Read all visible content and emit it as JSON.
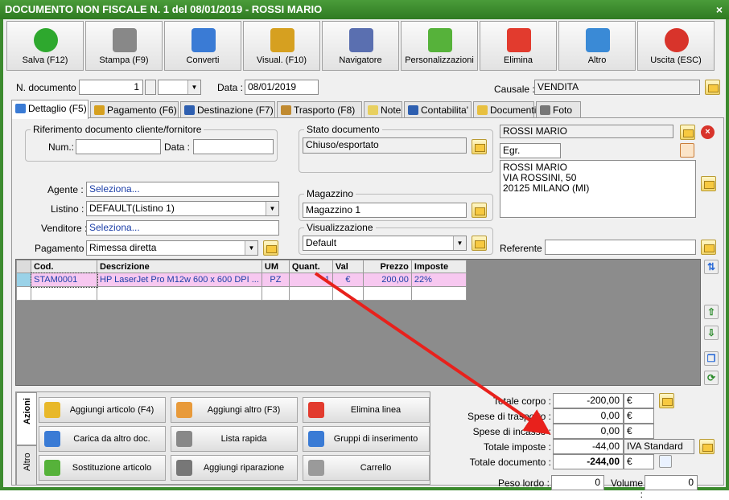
{
  "window": {
    "title": "DOCUMENTO NON FISCALE N. 1 del 08/01/2019 - ROSSI MARIO",
    "close": "×"
  },
  "toolbar": [
    {
      "label": "Salva (F12)",
      "icon": "check-icon",
      "color": "#2ea82e"
    },
    {
      "label": "Stampa (F9)",
      "icon": "printer-icon",
      "color": "#888888"
    },
    {
      "label": "Converti",
      "icon": "convert-icon",
      "color": "#3a7bd5"
    },
    {
      "label": "Visual. (F10)",
      "icon": "magic-wand-icon",
      "color": "#d6a020"
    },
    {
      "label": "Navigatore",
      "icon": "compass-icon",
      "color": "#5a6fb0"
    },
    {
      "label": "Personalizzazioni",
      "icon": "puzzle-icon",
      "color": "#56b23a"
    },
    {
      "label": "Elimina",
      "icon": "delete-x-icon",
      "color": "#e23b2e"
    },
    {
      "label": "Altro",
      "icon": "magnifier-icon",
      "color": "#3a8ad6"
    },
    {
      "label": "Uscita (ESC)",
      "icon": "power-icon",
      "color": "#d8342b"
    }
  ],
  "header": {
    "ndoc_label": "N. documento :",
    "ndoc_value": "1",
    "data_label": "Data :",
    "data_value": "08/01/2019",
    "causale_label": "Causale :",
    "causale_value": "VENDITA"
  },
  "tabs": [
    {
      "label": "Dettaglio (F5)",
      "color": "#3a7bd5"
    },
    {
      "label": "Pagamento (F6)",
      "color": "#d6a020"
    },
    {
      "label": "Destinazione (F7)",
      "color": "#2e5fb0"
    },
    {
      "label": "Trasporto (F8)",
      "color": "#c08a30"
    },
    {
      "label": "Note",
      "color": "#e8d060"
    },
    {
      "label": "Contabilita'",
      "color": "#2e5fb0"
    },
    {
      "label": "Documenti",
      "color": "#e8c040"
    },
    {
      "label": "Foto",
      "color": "#777777"
    }
  ],
  "riferimento": {
    "title": "Riferimento documento cliente/fornitore",
    "num_label": "Num.:",
    "data_label": "Data :"
  },
  "fields": {
    "agente_label": "Agente :",
    "agente_value": "Seleziona...",
    "listino_label": "Listino :",
    "listino_value": "DEFAULT(Listino 1)",
    "venditore_label": "Venditore :",
    "venditore_value": "Seleziona...",
    "pagamento_label": "Pagamento :",
    "pagamento_value": "Rimessa diretta"
  },
  "stato": {
    "title": "Stato documento",
    "value": "Chiuso/esportato"
  },
  "magazzino": {
    "title": "Magazzino",
    "value": "Magazzino 1"
  },
  "visualizzazione": {
    "title": "Visualizzazione",
    "value": "Default"
  },
  "cliente": {
    "name": "ROSSI MARIO",
    "title": "Egr.",
    "address": [
      "ROSSI MARIO",
      "VIA ROSSINI, 50",
      "20125 MILANO (MI)"
    ],
    "referente_label": "Referente"
  },
  "grid": {
    "columns": [
      "Cod.",
      "Descrizione",
      "UM",
      "Quant.",
      "Val",
      "Prezzo",
      "Imposte"
    ],
    "rows": [
      [
        "STAM0001",
        "HP LaserJet Pro M12w 600 x 600 DPI ...",
        "PZ",
        "-1",
        "€",
        "200,00",
        "22%"
      ]
    ]
  },
  "actions": {
    "tab_azioni": "Azioni",
    "tab_altro": "Altro",
    "buttons": [
      {
        "label": "Aggiungi articolo (F4)",
        "icon": "add-box-icon"
      },
      {
        "label": "Aggiungi altro (F3)",
        "icon": "add-grid-icon"
      },
      {
        "label": "Elimina linea",
        "icon": "delete-x-icon"
      },
      {
        "label": "Carica da altro doc.",
        "icon": "load-doc-icon"
      },
      {
        "label": "Lista rapida",
        "icon": "quick-list-icon"
      },
      {
        "label": "Gruppi di inserimento",
        "icon": "group-add-icon"
      },
      {
        "label": "Sostituzione articolo",
        "icon": "replace-icon"
      },
      {
        "label": "Aggiungi riparazione",
        "icon": "wrench-icon"
      },
      {
        "label": "Carrello",
        "icon": "cart-icon"
      }
    ]
  },
  "totals": {
    "corpo_label": "Totale corpo :",
    "corpo_value": "-200,00",
    "corpo_cur": "€",
    "trasporto_label": "Spese di trasporto :",
    "trasporto_value": "0,00",
    "trasporto_cur": "€",
    "incasso_label": "Spese di incasso :",
    "incasso_value": "0,00",
    "incasso_cur": "€",
    "imposte_label": "Totale imposte :",
    "imposte_value": "-44,00",
    "imposte_desc": "IVA Standard",
    "documento_label": "Totale documento :",
    "documento_value": "-244,00",
    "documento_cur": "€",
    "peso_label": "Peso lordo :",
    "peso_value": "0",
    "volume_label": "Volume :",
    "volume_value": "0"
  }
}
